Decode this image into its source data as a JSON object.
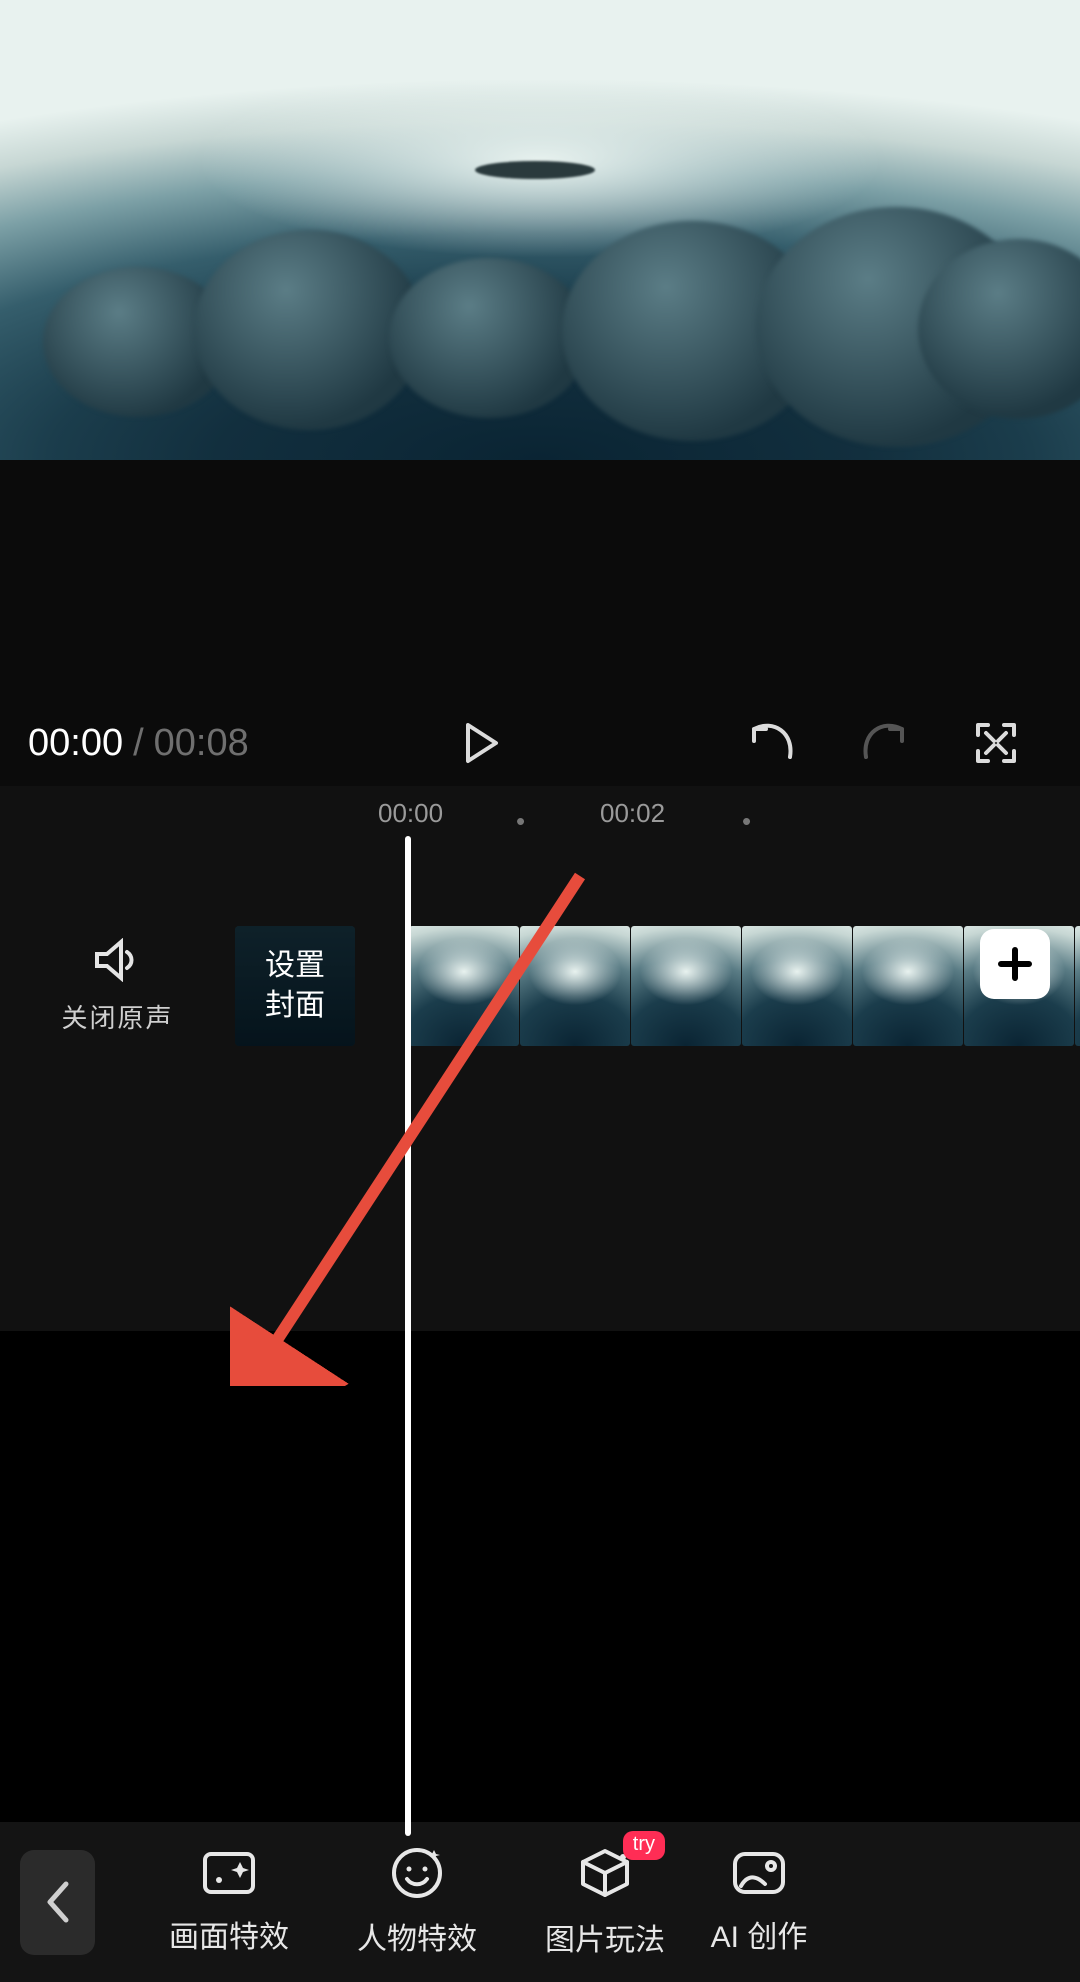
{
  "player": {
    "current_time": "00:00",
    "separator": "/",
    "total_time": "00:08"
  },
  "ruler": {
    "marks": [
      "00:00",
      "00:02"
    ]
  },
  "track": {
    "mute_label": "关闭原声",
    "cover_label": "设置\n封面"
  },
  "toolbar": {
    "items": [
      {
        "label": "画面特效",
        "badge": null
      },
      {
        "label": "人物特效",
        "badge": null
      },
      {
        "label": "图片玩法",
        "badge": "try"
      },
      {
        "label": "AI 创作",
        "badge": null
      }
    ]
  }
}
